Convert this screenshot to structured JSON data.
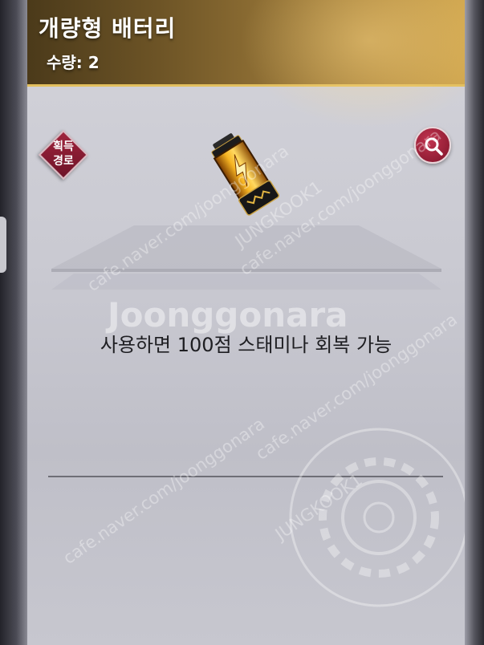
{
  "item": {
    "name": "개량형 배터리",
    "quantity_label": "수량: 2",
    "description": "사용하면 100점 스태미나 회복 가능"
  },
  "actions": {
    "acquisition_route": "획득\n경로",
    "acquisition_line1": "획득",
    "acquisition_line2": "경로",
    "magnify_icon": "magnifier-icon"
  },
  "watermarks": {
    "cafe": "cafe.naver.com/joonggonara",
    "brand": "Joonggonara",
    "user": "JUNGKOOK1"
  },
  "colors": {
    "header_gold": "#b38b3f",
    "accent_red": "#a0243c",
    "battery_gold": "#f2a81c"
  }
}
